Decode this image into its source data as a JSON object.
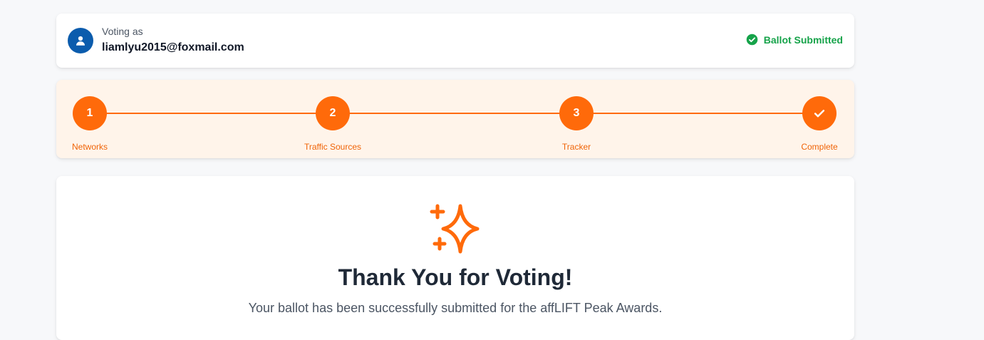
{
  "voter": {
    "voting_as_label": "Voting as",
    "email": "liamlyu2015@foxmail.com",
    "avatar_icon": "user-icon"
  },
  "status": {
    "label": "Ballot Submitted",
    "icon": "check-circle-icon",
    "color": "#16a34a"
  },
  "stepper": {
    "accent": "#ff6a0a",
    "steps": [
      {
        "number": "1",
        "label": "Networks"
      },
      {
        "number": "2",
        "label": "Traffic Sources"
      },
      {
        "number": "3",
        "label": "Tracker"
      },
      {
        "number": "",
        "label": "Complete",
        "icon": "check-icon"
      }
    ]
  },
  "confirmation": {
    "icon": "sparkles-icon",
    "title": "Thank You for Voting!",
    "message": "Your ballot has been successfully submitted for the affLIFT Peak Awards."
  }
}
